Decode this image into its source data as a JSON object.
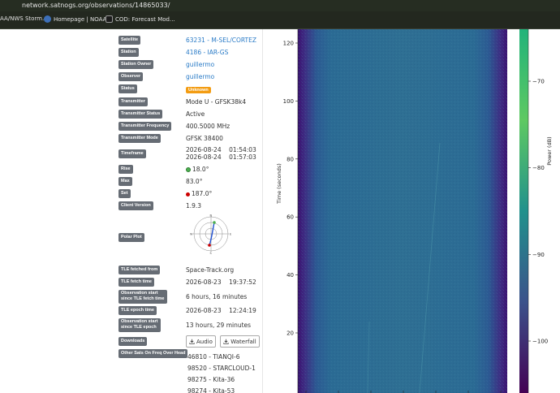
{
  "browser": {
    "url": "network.satnogs.org/observations/14865033/",
    "bookmarks": [
      "AA/NWS Storm...",
      "Homepage | NOAA...",
      "COD: Forecast Mod..."
    ]
  },
  "details": {
    "satellite_label": "Satellite",
    "satellite_value": "63231 - M-SEL/CORTEZ",
    "station_label": "Station",
    "station_value": "4186 - IAR-GS",
    "owner_label": "Station Owner",
    "owner_value": "guillermo",
    "observer_label": "Observer",
    "observer_value": "guillermo",
    "status_label": "Status",
    "status_value": "Unknown",
    "transmitter_label": "Transmitter",
    "transmitter_value": "Mode U - GFSK38k4",
    "tx_status_label": "Transmitter Status",
    "tx_status_value": "Active",
    "tx_freq_label": "Transmitter Frequency",
    "tx_freq_value": "400.5000 MHz",
    "tx_mode_label": "Transmitter Mode",
    "tx_mode_value": "GFSK 38400",
    "timeframe_label": "Timeframe",
    "timeframe_start": "2026-08-24    01:54:03",
    "timeframe_end": "2026-08-24    01:57:03",
    "rise_label": "Rise",
    "rise_value": "18.0°",
    "max_label": "Max",
    "max_value": "83.0°",
    "set_label": "Set",
    "set_value": "187.0°",
    "client_label": "Client Version",
    "client_value": "1.9.3",
    "polar_label": "Polar Plot",
    "polar_n": "N",
    "polar_e": "E",
    "polar_s": "S",
    "polar_w": "W",
    "tle_from_label": "TLE fetched from",
    "tle_from_value": "Space-Track.org",
    "tle_time_label": "TLE fetch time",
    "tle_time_value": "2026-08-23    19:37:52",
    "obs_since_fetch_label_1": "Observation start",
    "obs_since_fetch_label_2": "since TLE fetch time",
    "obs_since_fetch_value": "6 hours, 16 minutes",
    "tle_epoch_label": "TLE epoch time",
    "tle_epoch_value": "2026-08-23    12:24:19",
    "obs_since_epoch_label_1": "Observation start",
    "obs_since_epoch_label_2": "since TLE epoch",
    "obs_since_epoch_value": "13 hours, 29 minutes",
    "downloads_label": "Downloads",
    "audio_button": "Audio",
    "waterfall_button": "Waterfall",
    "other_sats_label": "Other Sats On Freq Over Head",
    "other_sats": [
      "46810 - TIANQI-6",
      "98520 - STARCLOUD-1",
      "98275 - Kita-36",
      "98274 - Kita-53"
    ]
  },
  "colors": {
    "label_bg": "#666c74",
    "link": "#2a7bc7",
    "status_badge": "#f39c12",
    "rise_dot": "#4caf50",
    "set_dot": "#cc0000"
  },
  "chart_data": {
    "type": "heatmap",
    "title": "",
    "ylabel": "Time (seconds)",
    "yticks": [
      20,
      40,
      60,
      80,
      100,
      120
    ],
    "ylim": [
      0,
      125
    ],
    "colorbar_label": "Power (dB)",
    "colorbar_ticks": [
      -70,
      -80,
      -90,
      -100
    ],
    "colorbar_range": [
      -106,
      -64
    ],
    "colormap": "viridis",
    "grid": false
  }
}
